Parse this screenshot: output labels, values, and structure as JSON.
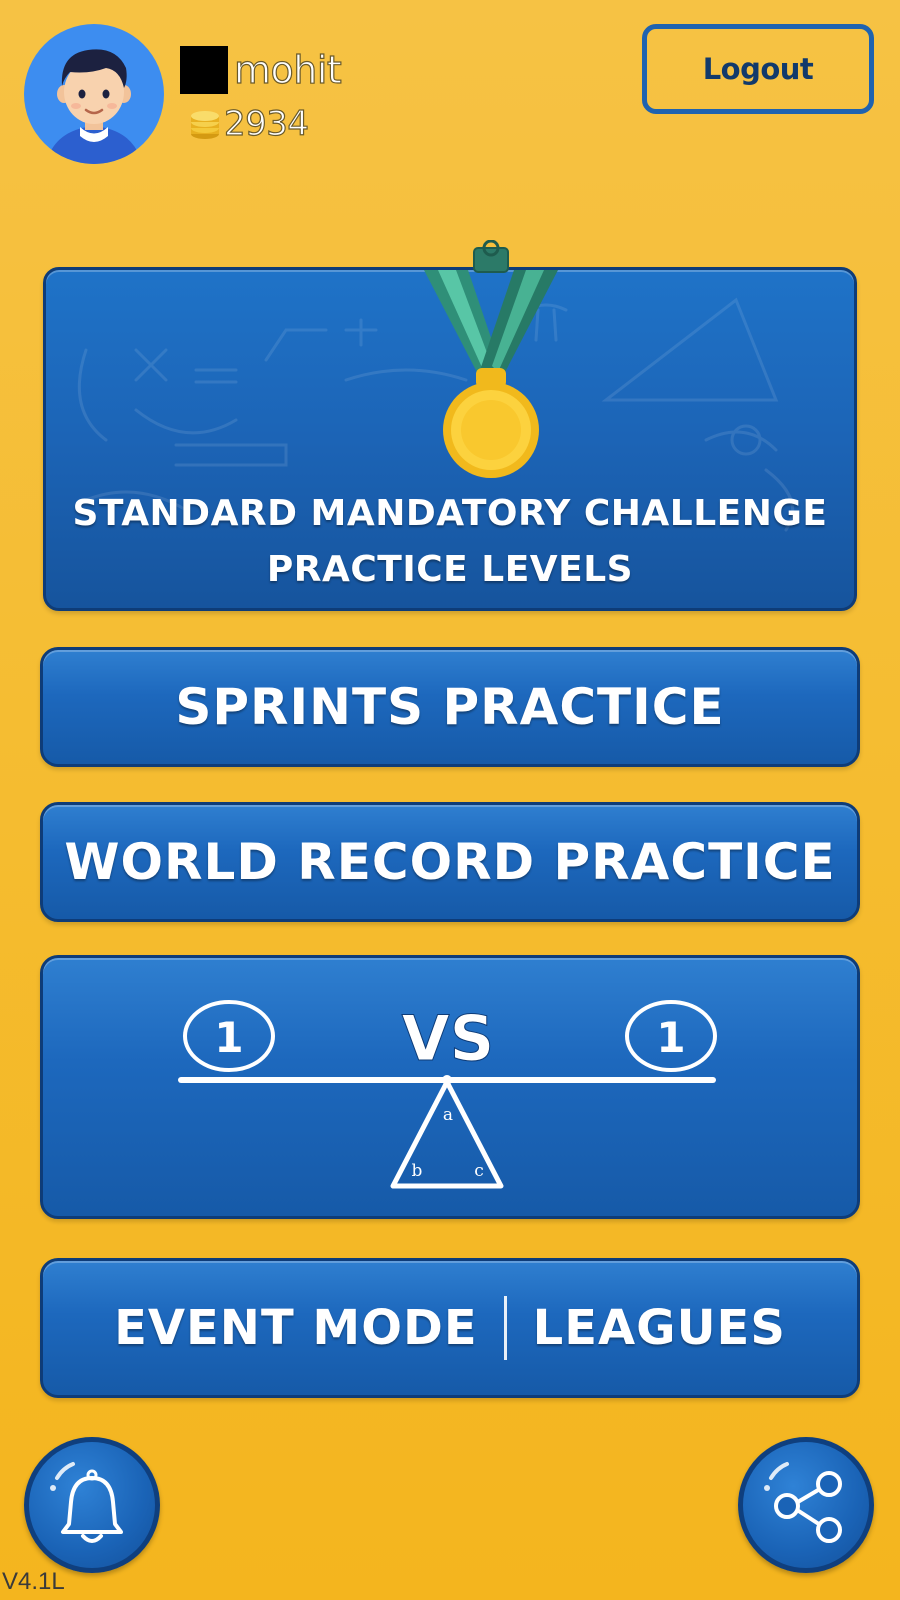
{
  "header": {
    "username": "mohit",
    "coins": "2934",
    "logout_label": "Logout"
  },
  "icons": {
    "avatar": "boy-avatar-icon",
    "flag": "flag-square-icon",
    "coins": "coin-stack-icon",
    "medal": "gold-medal-icon",
    "bell": "bell-icon",
    "share": "share-icon"
  },
  "cards": {
    "challenge_title_line1": "STANDARD MANDATORY CHALLENGE",
    "challenge_title_line2": "PRACTICE LEVELS",
    "sprints_label": "SPRINTS PRACTICE",
    "world_record_label": "WORLD RECORD PRACTICE",
    "versus": {
      "left_player": "1",
      "vs_label": "VS",
      "right_player": "1",
      "triangle_labels": [
        "a",
        "b",
        "c"
      ]
    },
    "event_label": "EVENT MODE",
    "leagues_label": "LEAGUES"
  },
  "footer": {
    "version": "V4.1L"
  },
  "colors": {
    "background": "#f5bd32",
    "card_blue": "#1d68bd",
    "card_border": "#0e3c78",
    "text_white": "#ffffff",
    "logout_border": "#1f63b0",
    "logout_text": "#123a6b"
  }
}
